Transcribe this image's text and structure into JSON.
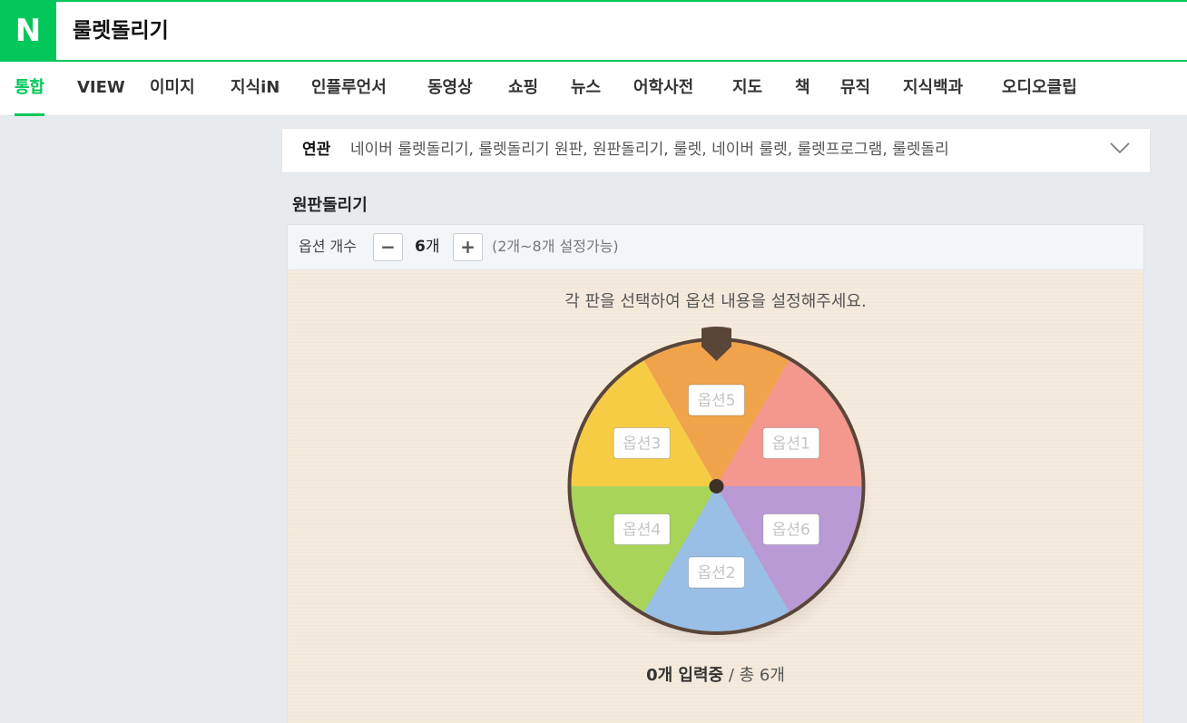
{
  "header": {
    "logo": "N",
    "query": "룰렛돌리기"
  },
  "tabs": [
    {
      "label": "통합",
      "active": true
    },
    {
      "label": "VIEW"
    },
    {
      "label": "이미지"
    },
    {
      "label": "지식iN"
    },
    {
      "label": "인플루언서"
    },
    {
      "label": "동영상"
    },
    {
      "label": "쇼핑"
    },
    {
      "label": "뉴스"
    },
    {
      "label": "어학사전"
    },
    {
      "label": "지도"
    },
    {
      "label": "책"
    },
    {
      "label": "뮤직"
    },
    {
      "label": "지식백과"
    },
    {
      "label": "오디오클립"
    }
  ],
  "related": {
    "title": "연관",
    "items": "네이버 룰렛돌리기, 룰렛돌리기 원판, 원판돌리기, 룰렛, 네이버 룰렛, 룰렛프로그램, 룰렛돌리"
  },
  "roulette": {
    "title": "원판돌리기",
    "option_label": "옵션 개수",
    "minus": "−",
    "plus": "+",
    "count": "6",
    "count_unit": "개",
    "range_note": "(2개~8개 설정가능)",
    "instruction": "각 판을 선택하여 옵션 내용을 설정해주세요.",
    "status_strong": "0개 입력중",
    "status_rest": " / 총 6개",
    "segments": [
      {
        "label": "옵션1",
        "color": "#f4978e"
      },
      {
        "label": "옵션6",
        "color": "#b99ad4"
      },
      {
        "label": "옵션2",
        "color": "#99bfe6"
      },
      {
        "label": "옵션4",
        "color": "#a8d45a"
      },
      {
        "label": "옵션3",
        "color": "#f6cc45"
      },
      {
        "label": "옵션5",
        "color": "#f0a34a"
      }
    ]
  },
  "colors": {
    "brand": "#03c75a",
    "rim": "#5a4638"
  }
}
